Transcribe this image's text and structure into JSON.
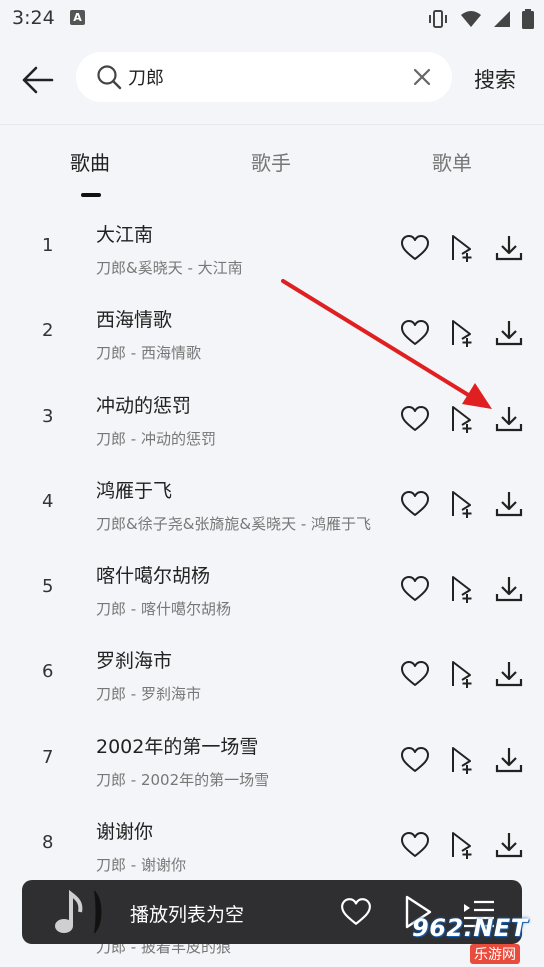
{
  "status_bar": {
    "time": "3:24",
    "indicator": "A"
  },
  "search": {
    "query": "刀郎",
    "action_label": "搜索"
  },
  "tabs": [
    {
      "label": "歌曲",
      "active": true
    },
    {
      "label": "歌手",
      "active": false
    },
    {
      "label": "歌单",
      "active": false
    }
  ],
  "songs": [
    {
      "index": "1",
      "title": "大江南",
      "subtitle": "刀郎&奚晓天 - 大江南"
    },
    {
      "index": "2",
      "title": "西海情歌",
      "subtitle": "刀郎 - 西海情歌"
    },
    {
      "index": "3",
      "title": "冲动的惩罚",
      "subtitle": "刀郎 - 冲动的惩罚"
    },
    {
      "index": "4",
      "title": "鸿雁于飞",
      "subtitle": "刀郎&徐子尧&张旖旎&奚晓天 - 鸿雁于飞"
    },
    {
      "index": "5",
      "title": "喀什噶尔胡杨",
      "subtitle": "刀郎 - 喀什噶尔胡杨"
    },
    {
      "index": "6",
      "title": "罗刹海市",
      "subtitle": "刀郎 - 罗刹海市"
    },
    {
      "index": "7",
      "title": "2002年的第一场雪",
      "subtitle": "刀郎 - 2002年的第一场雪"
    },
    {
      "index": "8",
      "title": "谢谢你",
      "subtitle": "刀郎 - 谢谢你"
    }
  ],
  "next_row_peek": "刀郎 - 披着羊皮的狼",
  "player": {
    "status": "播放列表为空"
  },
  "watermark": {
    "brand": "962.NET",
    "sub": "乐游网"
  },
  "icons": {
    "row_actions": [
      "heart-icon",
      "add-to-playlist-icon",
      "download-icon"
    ],
    "player": [
      "music-note-icon",
      "heart-icon",
      "play-icon",
      "playlist-icon"
    ]
  },
  "colors": {
    "annotation_arrow": "#e02020",
    "player_bg": "#2f2f32"
  }
}
